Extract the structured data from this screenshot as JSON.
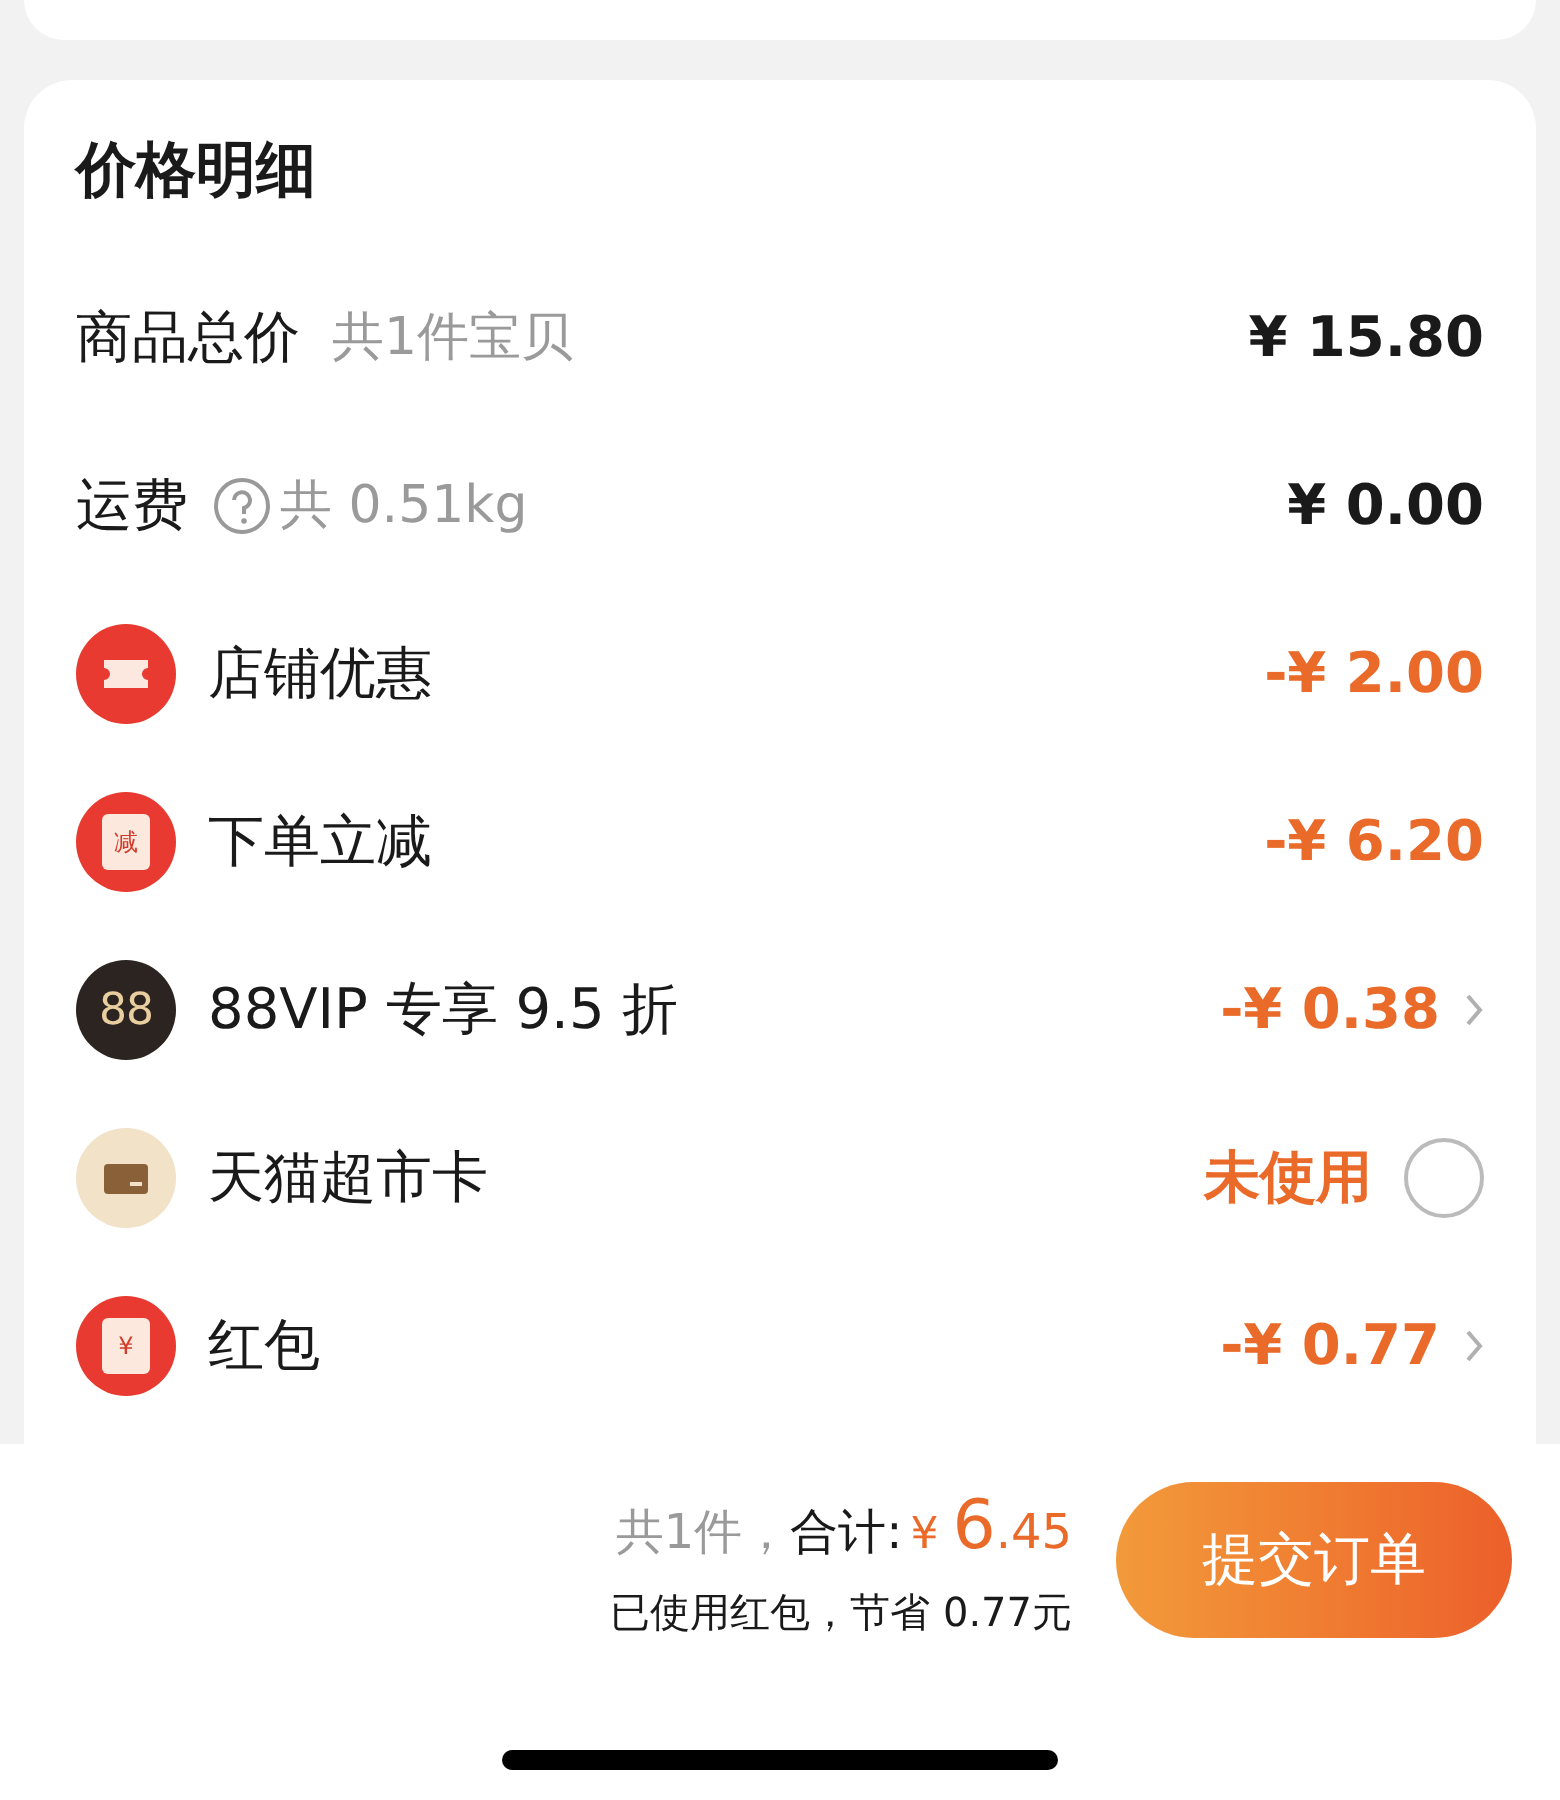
{
  "card_title": "价格明细",
  "rows": [
    {
      "kind": "plain",
      "label": "商品总价",
      "note": "共1件宝贝",
      "help": false,
      "value": "¥ 15.80"
    },
    {
      "kind": "plain",
      "label": "运费",
      "note": "共 0.51kg",
      "help": true,
      "value": "¥ 0.00"
    },
    {
      "kind": "coupon",
      "label": "店铺优惠",
      "value": "-¥ 2.00",
      "chevron": false
    },
    {
      "kind": "packet",
      "icon_text": "减",
      "label": "下单立减",
      "value": "-¥ 6.20",
      "chevron": false
    },
    {
      "kind": "vip",
      "icon_text": "88",
      "label": "88VIP 专享 9.5 折",
      "value": "-¥ 0.38",
      "chevron": true
    },
    {
      "kind": "card",
      "label": "天猫超市卡",
      "status": "未使用",
      "checked": false
    },
    {
      "kind": "packet",
      "icon_text": "¥",
      "label": "红包",
      "value": "-¥ 0.77",
      "chevron": true
    }
  ],
  "footer": {
    "count": "共1件，",
    "total_label": "合计:",
    "currency": "¥",
    "total_int": "6",
    "total_dec": ".45",
    "savings": "已使用红包，节省 0.77元",
    "submit": "提交订单"
  }
}
